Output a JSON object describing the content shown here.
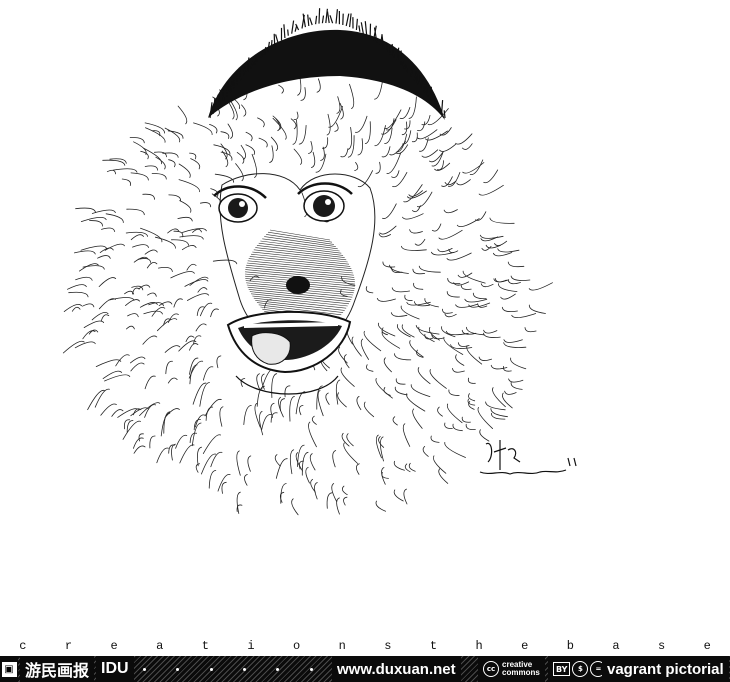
{
  "image": {
    "subject": "pen-and-ink drawing of a monkey face",
    "signature": "Duxuan"
  },
  "letter_strip": [
    "c",
    "r",
    "e",
    "a",
    "t",
    "i",
    "o",
    "n",
    "s",
    "t",
    "h",
    "e",
    "b",
    "a",
    "s",
    "e"
  ],
  "footer": {
    "chinese_title": "游民画报",
    "short_brand": "IDU",
    "website": "www.duxuan.net",
    "cc_label_line1": "creative",
    "cc_label_line2": "commons",
    "license": "BY",
    "brand": "vagrant pictorial"
  },
  "colors": {
    "ink": "#0b0b0b",
    "paper": "#ffffff"
  }
}
